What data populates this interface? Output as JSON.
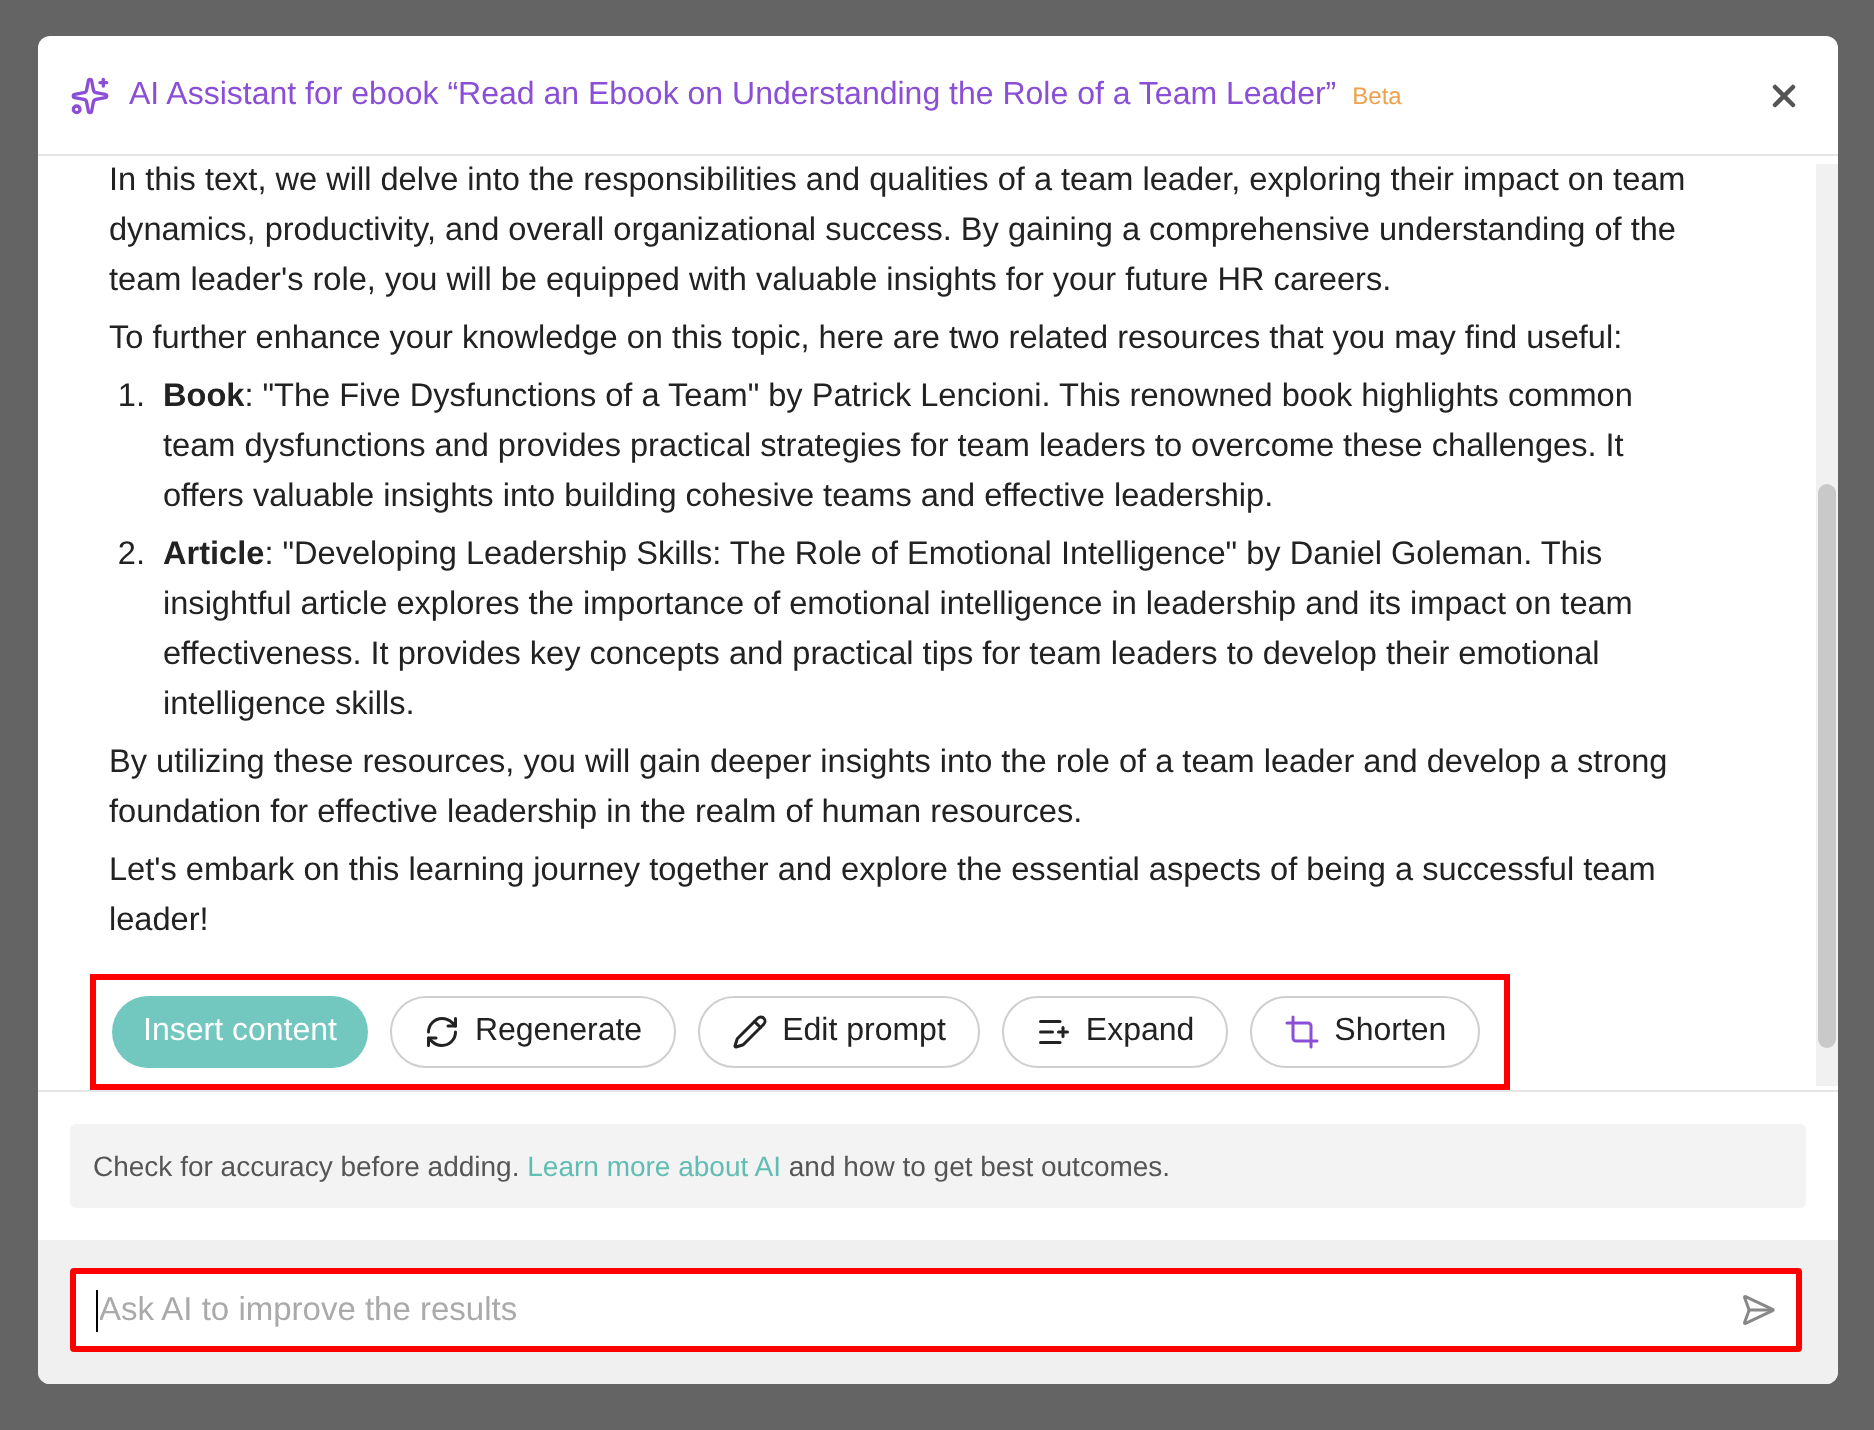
{
  "dialog": {
    "title": "AI Assistant for ebook “Read an Ebook on Understanding the Role of a Team Leader”",
    "badge": "Beta"
  },
  "content": {
    "blocks": [
      {
        "kind": "paragraph",
        "text": "In this text, we will delve into the responsibilities and qualities of a team leader, exploring their impact on team dynamics, productivity, and overall organizational success. By gaining a comprehensive understanding of the team leader's role, you will be equipped with valuable insights for your future HR careers."
      },
      {
        "kind": "paragraph",
        "text": "To further enhance your knowledge on this topic, here are two related resources that you may find useful:"
      },
      {
        "kind": "list",
        "items": [
          {
            "number": "1.",
            "text": "**Book**: \"The Five Dysfunctions of a Team\" by Patrick Lencioni. This renowned book highlights common team dysfunctions and provides practical strategies for team leaders to overcome these challenges. It offers valuable insights into building cohesive teams and effective leadership."
          },
          {
            "number": "2.",
            "text": "**Article**: \"Developing Leadership Skills: The Role of Emotional Intelligence\" by Daniel Goleman. This insightful article explores the importance of emotional intelligence in leadership and its impact on team effectiveness. It provides key concepts and practical tips for team leaders to develop their emotional intelligence skills."
          }
        ]
      },
      {
        "kind": "paragraph",
        "text": "By utilizing these resources, you will gain deeper insights into the role of a team leader and develop a strong foundation for effective leadership in the realm of human resources."
      },
      {
        "kind": "paragraph",
        "text": "Let's embark on this learning journey together and explore the essential aspects of being a successful team leader!"
      }
    ]
  },
  "actions": {
    "highlighted": true,
    "buttons": [
      {
        "kind": "primary",
        "label": "Insert content"
      },
      {
        "kind": "regenerate",
        "label": "Regenerate"
      },
      {
        "kind": "edit",
        "label": "Edit prompt"
      },
      {
        "kind": "expand",
        "label": "Expand"
      },
      {
        "kind": "shorten",
        "label": "Shorten"
      }
    ]
  },
  "notice": {
    "before": "Check for accuracy before adding.",
    "link": "Learn more about AI",
    "after": "and how to get best outcomes."
  },
  "prompt": {
    "highlighted": true,
    "placeholder": "Ask AI to improve the results"
  }
}
